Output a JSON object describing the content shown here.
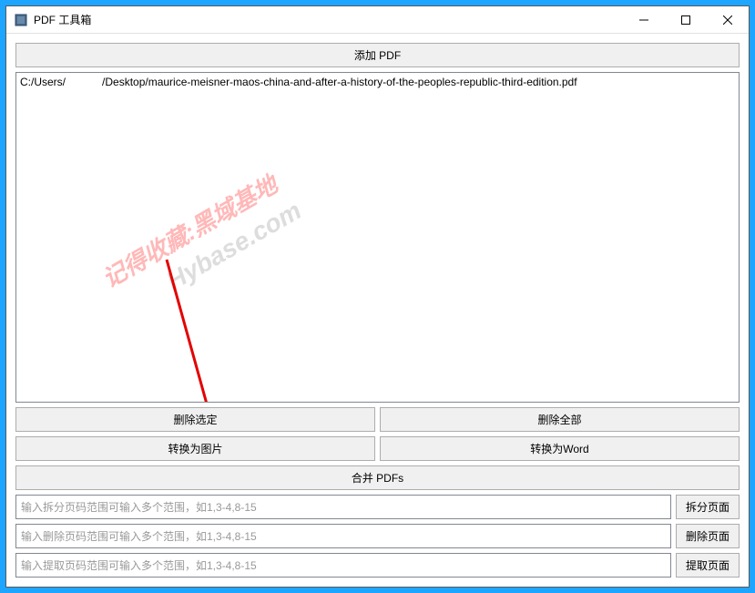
{
  "window": {
    "title": "PDF 工具箱"
  },
  "buttons": {
    "add_pdf": "添加 PDF",
    "delete_selected": "删除选定",
    "delete_all": "删除全部",
    "convert_image": "转换为图片",
    "convert_word": "转换为Word",
    "merge_pdfs": "合并 PDFs",
    "split_page": "拆分页面",
    "delete_page": "删除页面",
    "extract_page": "提取页面"
  },
  "inputs": {
    "split_placeholder": "输入拆分页码范围可输入多个范围，如1,3-4,8-15",
    "delete_placeholder": "输入删除页码范围可输入多个范围，如1,3-4,8-15",
    "extract_placeholder": "输入提取页码范围可输入多个范围，如1,3-4,8-15"
  },
  "filelist": {
    "items": [
      {
        "prefix": "C:/Users/",
        "suffix": "/Desktop/maurice-meisner-maos-china-and-after-a-history-of-the-peoples-republic-third-edition.pdf"
      }
    ]
  },
  "watermark": {
    "line1": "记得收藏:黑域基地",
    "line2": "Hybase.com"
  }
}
